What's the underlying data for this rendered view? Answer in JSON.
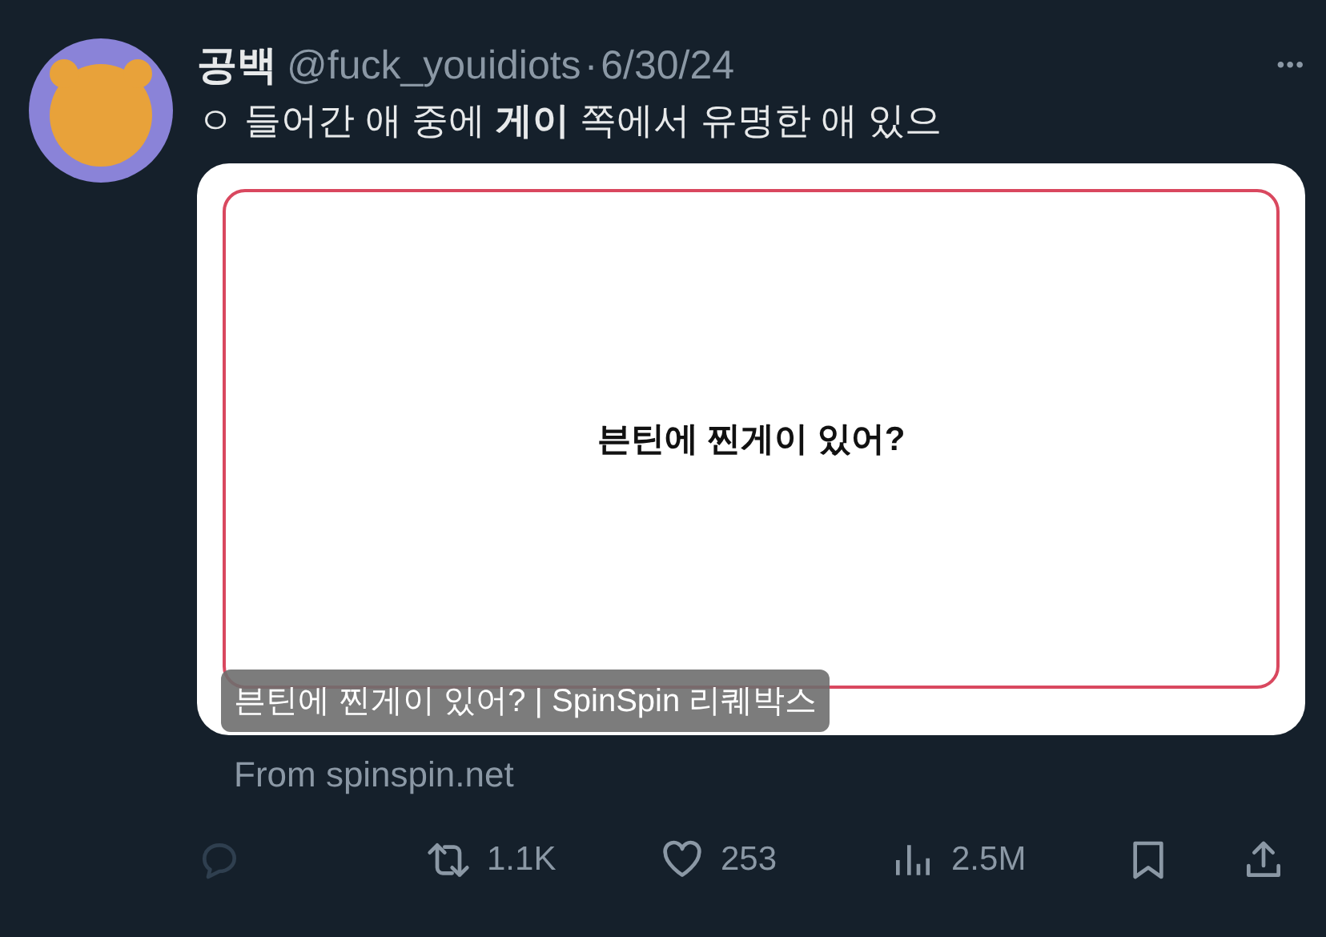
{
  "tweet": {
    "display_name": "공백",
    "handle": "@fuck_youidiots",
    "separator": "·",
    "date": "6/30/24",
    "more": "•••",
    "text": "ㅇ 들어간 애 중에 **게이** 쪽에서 유명한 애 있으"
  },
  "link_card": {
    "headline": "븐틴에 찐게이 있어?",
    "caption": "븐틴에 찐게이 있어? | SpinSpin 리퀘박스",
    "source": "From spinspin.net"
  },
  "actions": [
    {
      "kind": "reply"
    },
    {
      "kind": "retweet",
      "count": "1.1K"
    },
    {
      "kind": "like",
      "count": "253"
    },
    {
      "kind": "views",
      "count": "2.5M"
    },
    {
      "kind": "bookmark"
    },
    {
      "kind": "share"
    }
  ]
}
